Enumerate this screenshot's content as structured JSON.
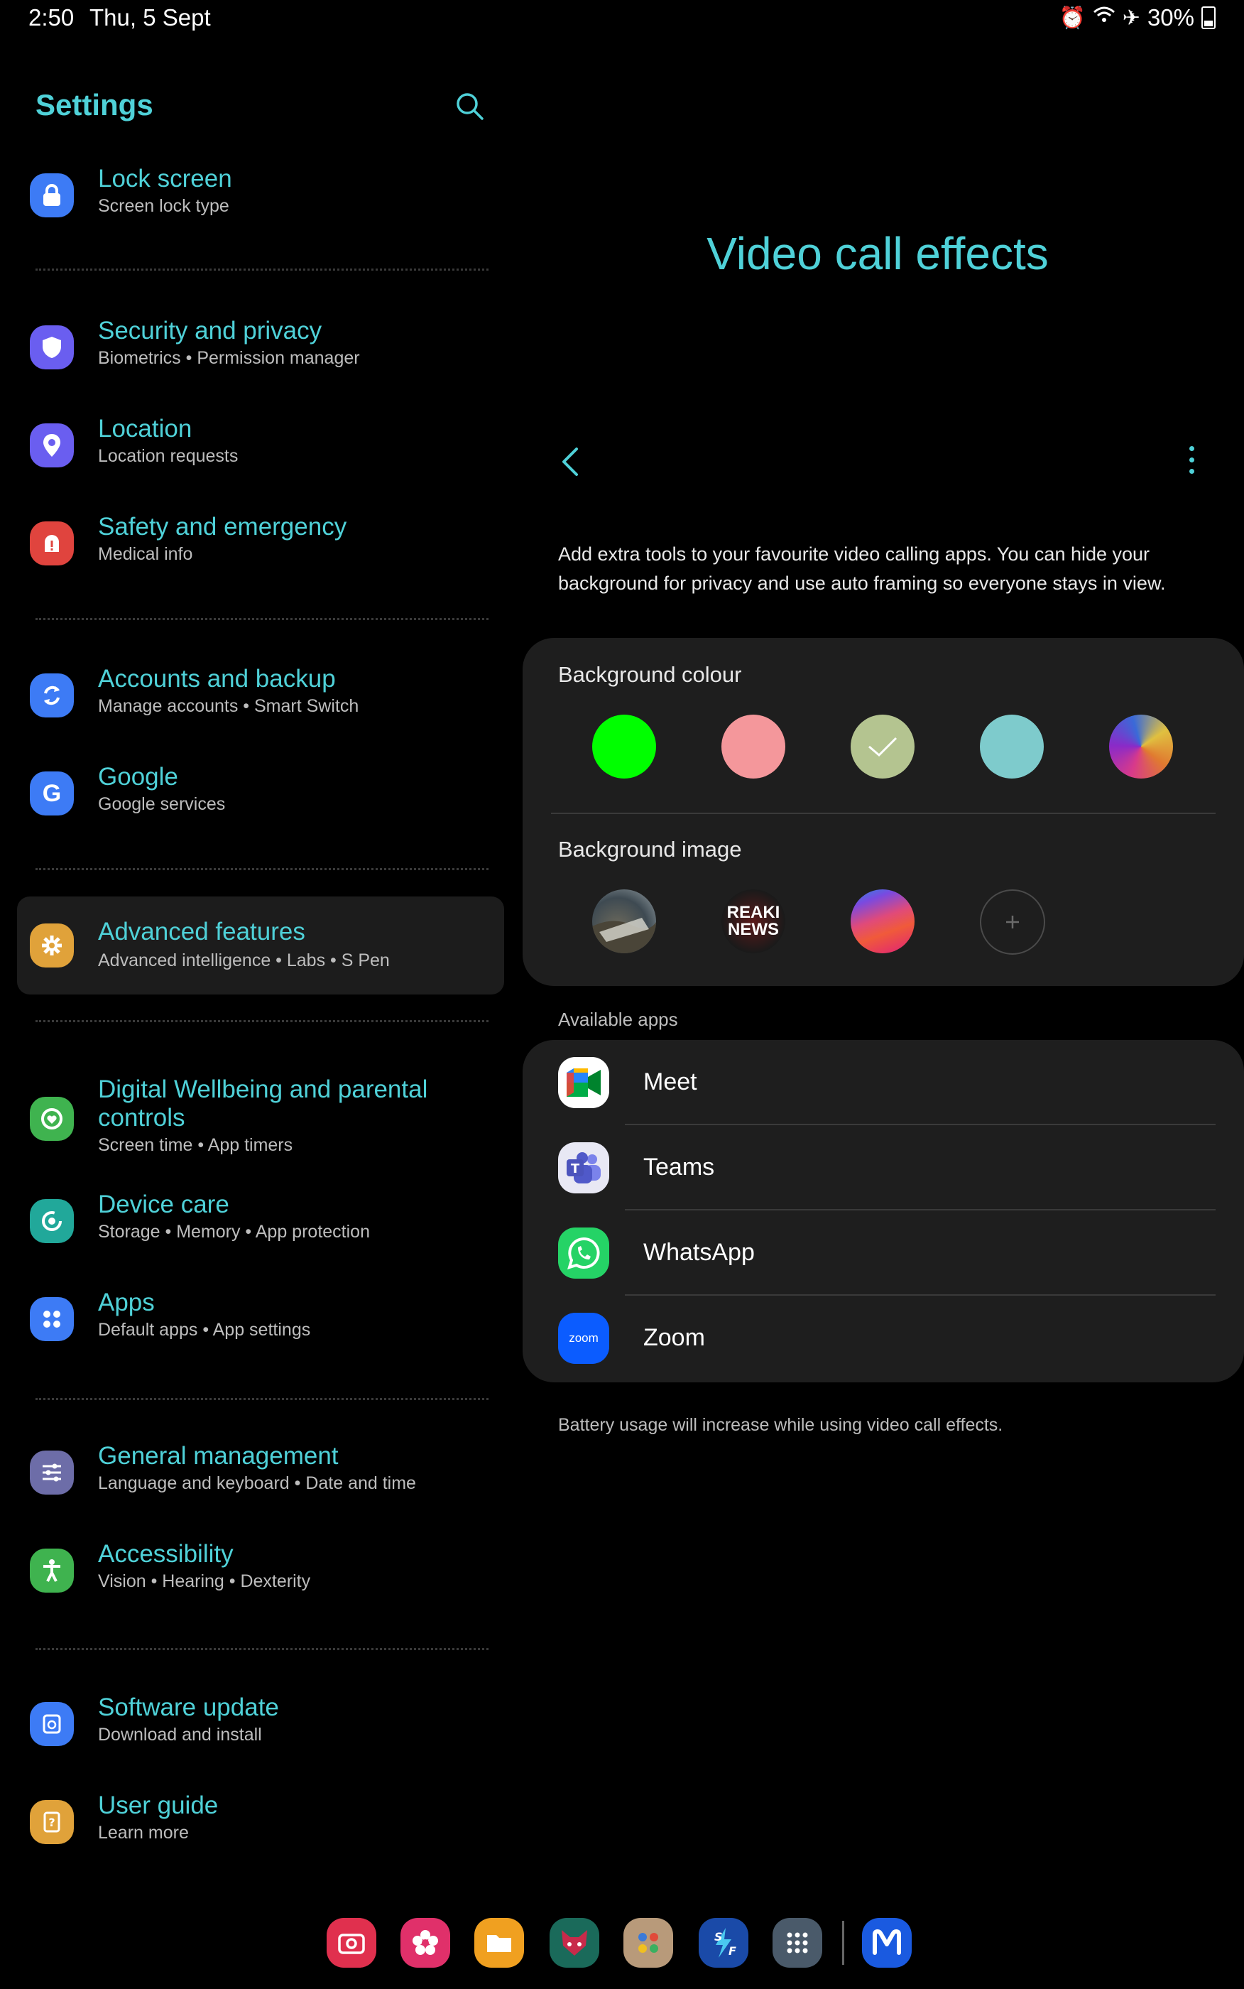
{
  "status_bar": {
    "time": "2:50",
    "date": "Thu, 5 Sept",
    "battery": "30%"
  },
  "settings": {
    "title": "Settings",
    "items": [
      {
        "title": "Lock screen",
        "subtitle": "Screen lock type",
        "icon": "lock-icon",
        "color": "#3d7bf5"
      },
      {
        "title": "Security and privacy",
        "subtitle": "Biometrics  •  Permission manager",
        "icon": "shield-icon",
        "color": "#6a5ef0"
      },
      {
        "title": "Location",
        "subtitle": "Location requests",
        "icon": "location-pin-icon",
        "color": "#6a5ef0"
      },
      {
        "title": "Safety and emergency",
        "subtitle": "Medical info",
        "icon": "alert-icon",
        "color": "#e0443e"
      },
      {
        "title": "Accounts and backup",
        "subtitle": "Manage accounts  •  Smart Switch",
        "icon": "sync-icon",
        "color": "#3d7bf5"
      },
      {
        "title": "Google",
        "subtitle": "Google services",
        "icon": "google-icon",
        "color": "#3d7bf5"
      },
      {
        "title": "Advanced features",
        "subtitle": "Advanced intelligence  •  Labs  •  S Pen",
        "icon": "puzzle-gear-icon",
        "color": "#e0a23a"
      },
      {
        "title": "Digital Wellbeing and parental controls",
        "subtitle": "Screen time  •  App timers",
        "icon": "wellbeing-icon",
        "color": "#3fb34f"
      },
      {
        "title": "Device care",
        "subtitle": "Storage  •  Memory  •  App protection",
        "icon": "device-care-icon",
        "color": "#21a89a"
      },
      {
        "title": "Apps",
        "subtitle": "Default apps  •  App settings",
        "icon": "apps-grid-icon",
        "color": "#3d7bf5"
      },
      {
        "title": "General management",
        "subtitle": "Language and keyboard  •  Date and time",
        "icon": "sliders-icon",
        "color": "#6d6da8"
      },
      {
        "title": "Accessibility",
        "subtitle": "Vision  •  Hearing  •  Dexterity",
        "icon": "accessibility-icon",
        "color": "#3fb34f"
      },
      {
        "title": "Software update",
        "subtitle": "Download and install",
        "icon": "update-icon",
        "color": "#3d7bf5"
      },
      {
        "title": "User guide",
        "subtitle": "Learn more",
        "icon": "guide-icon",
        "color": "#e0a23a"
      }
    ]
  },
  "detail": {
    "title": "Video call effects",
    "description": "Add extra tools to your favourite video calling apps. You can hide your background for privacy and use auto framing so everyone stays in view.",
    "background_colour_label": "Background colour",
    "colours": [
      "#00ff00",
      "#f4979b",
      "#b4c490",
      "#7ecbcc",
      "gradient"
    ],
    "selected_colour_index": 2,
    "background_image_label": "Background image",
    "image_text": "REAKI NEWS",
    "available_apps_label": "Available apps",
    "apps": [
      {
        "name": "Meet",
        "icon": "meet-icon"
      },
      {
        "name": "Teams",
        "icon": "teams-icon"
      },
      {
        "name": "WhatsApp",
        "icon": "whatsapp-icon"
      },
      {
        "name": "Zoom",
        "icon": "zoom-icon",
        "label": "zoom"
      }
    ],
    "battery_note": "Battery usage will increase while using video call effects."
  }
}
